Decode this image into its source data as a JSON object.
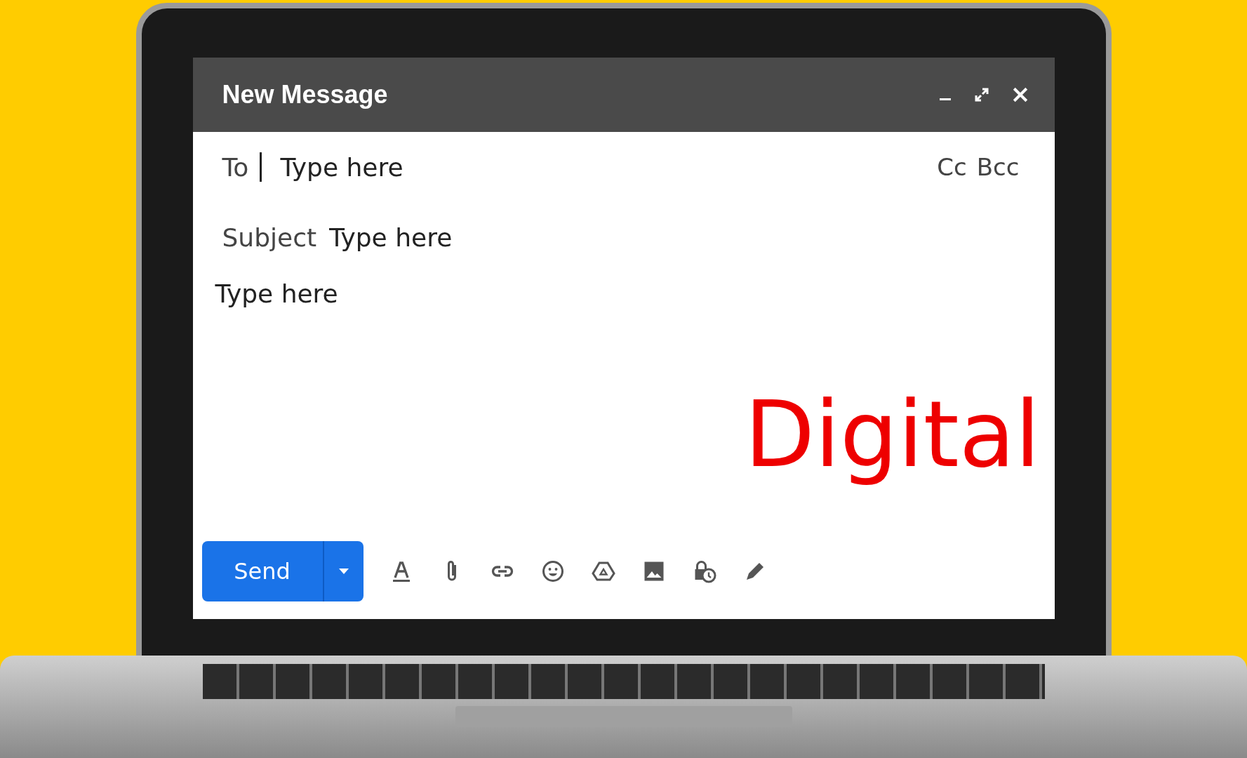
{
  "window": {
    "title": "New Message"
  },
  "to": {
    "label": "To",
    "placeholder": "Type here"
  },
  "copy_links": [
    "Cc",
    "Bcc"
  ],
  "subject": {
    "label": "Subject",
    "placeholder": "Type here"
  },
  "body": {
    "placeholder": "Type here"
  },
  "stamp": "Digital",
  "send_button": {
    "label": "Send"
  }
}
